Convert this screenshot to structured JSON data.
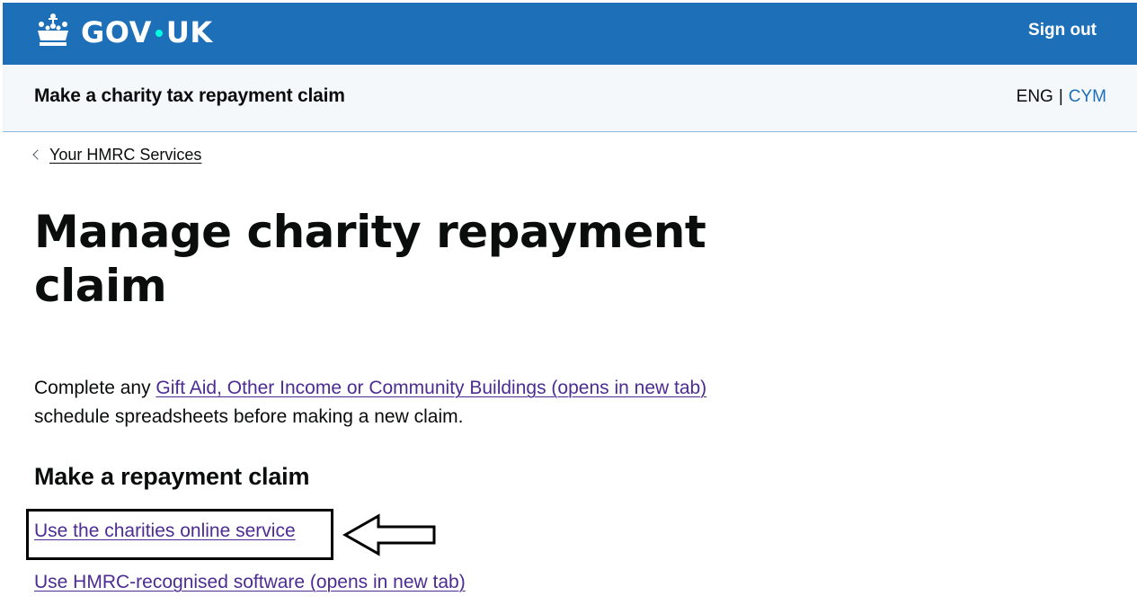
{
  "header": {
    "logo_text_left": "GOV",
    "logo_text_right": "UK",
    "sign_out": "Sign out",
    "brand_color": "#1d70b8",
    "dot_color": "#00ffe0"
  },
  "service_bar": {
    "service_name": "Make a charity tax repayment claim",
    "lang_current": "ENG",
    "lang_separator": "|",
    "lang_other": "CYM"
  },
  "back_link": {
    "label": "Your HMRC Services"
  },
  "main": {
    "title": "Manage charity repayment claim",
    "intro_prefix": "Complete any ",
    "intro_link": "Gift Aid, Other Income or Community Buildings (opens in new tab)",
    "intro_suffix": " schedule spreadsheets before making a new claim.",
    "section_heading": "Make a repayment claim",
    "links": [
      {
        "label": "Use the charities online service"
      },
      {
        "label": "Use HMRC-recognised software (opens in new tab)"
      }
    ],
    "link_color": "#4c2c92"
  }
}
